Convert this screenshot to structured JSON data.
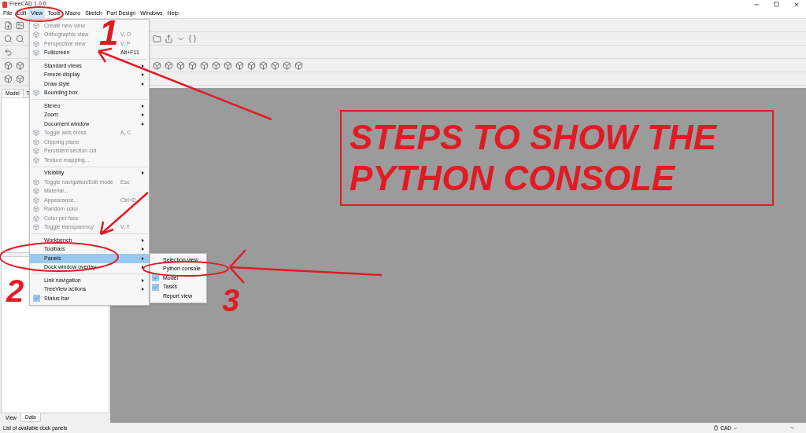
{
  "window": {
    "title": "FreeCAD 1.0.0"
  },
  "menu_bar": [
    {
      "label": "File",
      "selected": false
    },
    {
      "label": "Edit",
      "selected": false
    },
    {
      "label": "View",
      "selected": true
    },
    {
      "label": "Tools",
      "selected": false
    },
    {
      "label": "Macro",
      "selected": false
    },
    {
      "label": "Sketch",
      "selected": false
    },
    {
      "label": "Part Design",
      "selected": false
    },
    {
      "label": "Windows",
      "selected": false
    },
    {
      "label": "Help",
      "selected": false
    }
  ],
  "view_menu": [
    {
      "kind": "command",
      "label": "Create new view",
      "disabled": true,
      "selected": false
    },
    {
      "kind": "command",
      "label": "Orthographic view",
      "shortcut": "V, O",
      "disabled": true,
      "selected": false
    },
    {
      "kind": "command",
      "label": "Perspective view",
      "shortcut": "V, P",
      "disabled": true,
      "selected": false
    },
    {
      "kind": "command",
      "label": "Fullscreen",
      "shortcut": "Alt+F11",
      "disabled": false,
      "selected": false
    },
    {
      "kind": "separator"
    },
    {
      "kind": "submenu",
      "label": "Standard views",
      "disabled": false,
      "selected": false
    },
    {
      "kind": "submenu",
      "label": "Freeze display",
      "disabled": false,
      "selected": false
    },
    {
      "kind": "submenu",
      "label": "Draw style",
      "disabled": false,
      "selected": false
    },
    {
      "kind": "command",
      "label": "Bounding box",
      "disabled": false,
      "selected": false
    },
    {
      "kind": "separator"
    },
    {
      "kind": "submenu",
      "label": "Stereo",
      "disabled": false,
      "selected": false
    },
    {
      "kind": "submenu",
      "label": "Zoom",
      "disabled": false,
      "selected": false
    },
    {
      "kind": "submenu",
      "label": "Document window",
      "disabled": false,
      "selected": false
    },
    {
      "kind": "command",
      "label": "Toggle axis cross",
      "shortcut": "A, C",
      "disabled": true,
      "selected": false
    },
    {
      "kind": "command",
      "label": "Clipping plane",
      "disabled": true,
      "selected": false
    },
    {
      "kind": "command",
      "label": "Persistent section cut",
      "disabled": true,
      "selected": false
    },
    {
      "kind": "command",
      "label": "Texture mapping...",
      "disabled": true,
      "selected": false
    },
    {
      "kind": "separator"
    },
    {
      "kind": "submenu",
      "label": "Visibility",
      "disabled": false,
      "selected": false
    },
    {
      "kind": "command",
      "label": "Toggle navigation/Edit mode",
      "shortcut": "Esc",
      "disabled": true,
      "selected": false
    },
    {
      "kind": "command",
      "label": "Material...",
      "disabled": true,
      "selected": false
    },
    {
      "kind": "command",
      "label": "Appearance...",
      "shortcut": "Ctrl+D",
      "disabled": true,
      "selected": false
    },
    {
      "kind": "command",
      "label": "Random color",
      "disabled": true,
      "selected": false
    },
    {
      "kind": "command",
      "label": "Color per face",
      "disabled": true,
      "selected": false
    },
    {
      "kind": "command",
      "label": "Toggle transparency",
      "shortcut": "V, T",
      "disabled": true,
      "selected": false
    },
    {
      "kind": "separator"
    },
    {
      "kind": "submenu",
      "label": "Workbench",
      "disabled": false,
      "selected": false
    },
    {
      "kind": "submenu",
      "label": "Toolbars",
      "disabled": false,
      "selected": false
    },
    {
      "kind": "submenu",
      "label": "Panels",
      "disabled": false,
      "selected": true
    },
    {
      "kind": "submenu",
      "label": "Dock window overlay",
      "disabled": false,
      "selected": false
    },
    {
      "kind": "separator"
    },
    {
      "kind": "submenu",
      "label": "Link navigation",
      "disabled": false,
      "selected": false
    },
    {
      "kind": "submenu",
      "label": "TreeView actions",
      "disabled": false,
      "selected": false
    },
    {
      "kind": "toggle",
      "label": "Status bar",
      "checked": true,
      "disabled": false,
      "selected": false
    }
  ],
  "panels_submenu": [
    {
      "label": "Selection view",
      "checked": false
    },
    {
      "label": "Python console",
      "checked": false
    },
    {
      "label": "Model",
      "checked": true
    },
    {
      "label": "Tasks",
      "checked": true
    },
    {
      "label": "Report view",
      "checked": false
    }
  ],
  "left_panel": {
    "top_tabs": [
      {
        "label": "Model",
        "selected": true
      },
      {
        "label": "T",
        "selected": false
      }
    ],
    "bottom_tabs": [
      {
        "label": "View",
        "selected": false
      },
      {
        "label": "Data",
        "selected": true
      }
    ]
  },
  "status_bar": {
    "message": "List of available dock panels",
    "navigation": "CAD"
  },
  "annotations": {
    "steps": [
      "1",
      "2",
      "3"
    ],
    "callout": [
      "STEPS TO SHOW THE",
      "PYTHON CONSOLE"
    ]
  }
}
